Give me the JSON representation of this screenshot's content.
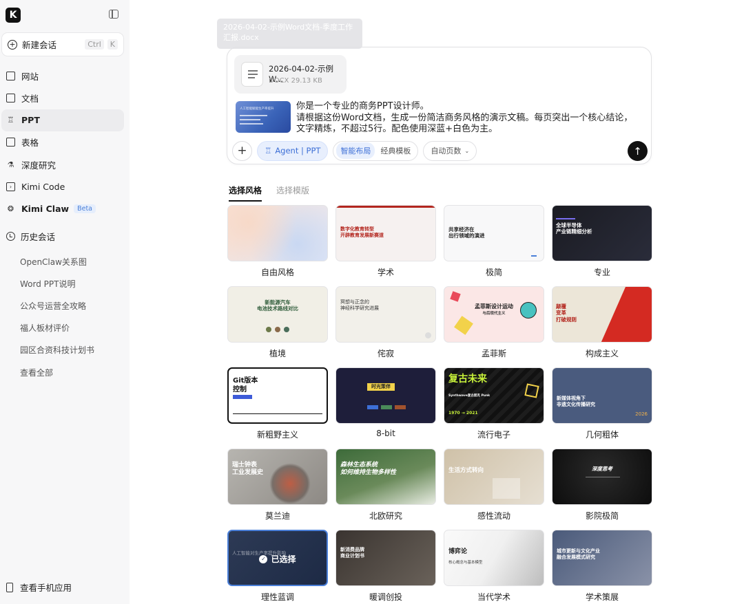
{
  "sidebar": {
    "logo": "K",
    "new_chat": {
      "label": "新建会话",
      "shortcut": [
        "Ctrl",
        "K"
      ]
    },
    "nav": [
      {
        "label": "网站",
        "icon": "website-icon"
      },
      {
        "label": "文档",
        "icon": "document-icon"
      },
      {
        "label": "PPT",
        "icon": "ppt-icon",
        "active": true
      },
      {
        "label": "表格",
        "icon": "table-icon"
      },
      {
        "label": "深度研究",
        "icon": "research-icon"
      },
      {
        "label": "Kimi Code",
        "icon": "terminal-icon"
      },
      {
        "label": "Kimi Claw",
        "icon": "claw-icon",
        "badge": "Beta"
      }
    ],
    "history_title": "历史会话",
    "history": [
      "OpenClaw关系图",
      "Word PPT说明",
      "公众号运营全攻略",
      "福人板材评价",
      "园区合资科技计划书",
      "查看全部"
    ],
    "mobile_app": "查看手机应用"
  },
  "tooltip": "2026-04-02-示例Word文档-季度工作汇报.docx",
  "composer": {
    "file": {
      "name": "2026-04-02-示例W...",
      "meta": "DOCX 29.13 KB"
    },
    "thumb_text": "人工智能赋能生产率提升",
    "prompt_line1": "你是一个专业的商务PPT设计师。",
    "prompt_line2": "请根据这份Word文档，生成一份简洁商务风格的演示文稿。每页突出一个核心结论，文字精炼，不超过5行。配色使用深蓝+白色为主。",
    "agent_label": "Agent | PPT",
    "layout_options": [
      "智能布局",
      "经典模板"
    ],
    "pages_label": "自动页数"
  },
  "tabs": [
    "选择风格",
    "选择模版"
  ],
  "styles": [
    {
      "label": "自由风格",
      "title": ""
    },
    {
      "label": "学术",
      "title": "数字化教育转型\n开辟教育发展新赛道"
    },
    {
      "label": "极简",
      "title": "共享经济在\n出行领域的演进"
    },
    {
      "label": "专业",
      "title": "全球半导体\n产业链精细分析"
    },
    {
      "label": "植境",
      "title": "新能源汽车\n电池技术路线对比"
    },
    {
      "label": "侘寂",
      "title": "冥想与正念的\n神经科学研究进展"
    },
    {
      "label": "孟菲斯",
      "title": "孟菲斯设计运动",
      "subtitle": "与后现代主义"
    },
    {
      "label": "构成主义",
      "title": "颠覆\n变革\n打破规则"
    },
    {
      "label": "新粗野主义",
      "title": "Git版本\n控制"
    },
    {
      "label": "8-bit",
      "title": "时光策伴"
    },
    {
      "label": "流行电子",
      "title": "复古未来",
      "subtitle": "Synthwave复古朋克 Punk",
      "years": "1970 → 2021"
    },
    {
      "label": "几何粗体",
      "title": "新媒体视角下\n非遗文化传播研究",
      "year": "2026"
    },
    {
      "label": "莫兰迪",
      "title": "瑞士钟表\n工业发展史"
    },
    {
      "label": "北欧研究",
      "title": "森林生态系统\n如何维持生物多样性"
    },
    {
      "label": "感性流动",
      "title": "生活方式转向"
    },
    {
      "label": "影院极简",
      "title": "深度思考"
    },
    {
      "label": "理性蓝调",
      "title": "人工智能对生产率提升影响",
      "selected": true,
      "selected_text": "已选择"
    },
    {
      "label": "暖调创投",
      "title": "新消费品牌\n商业计划书"
    },
    {
      "label": "当代学术",
      "title": "博弈论",
      "subtitle": "核心概念与基本模型"
    },
    {
      "label": "学术策展",
      "title": "城市更新与文化产业\n融合发展模式研究"
    }
  ]
}
